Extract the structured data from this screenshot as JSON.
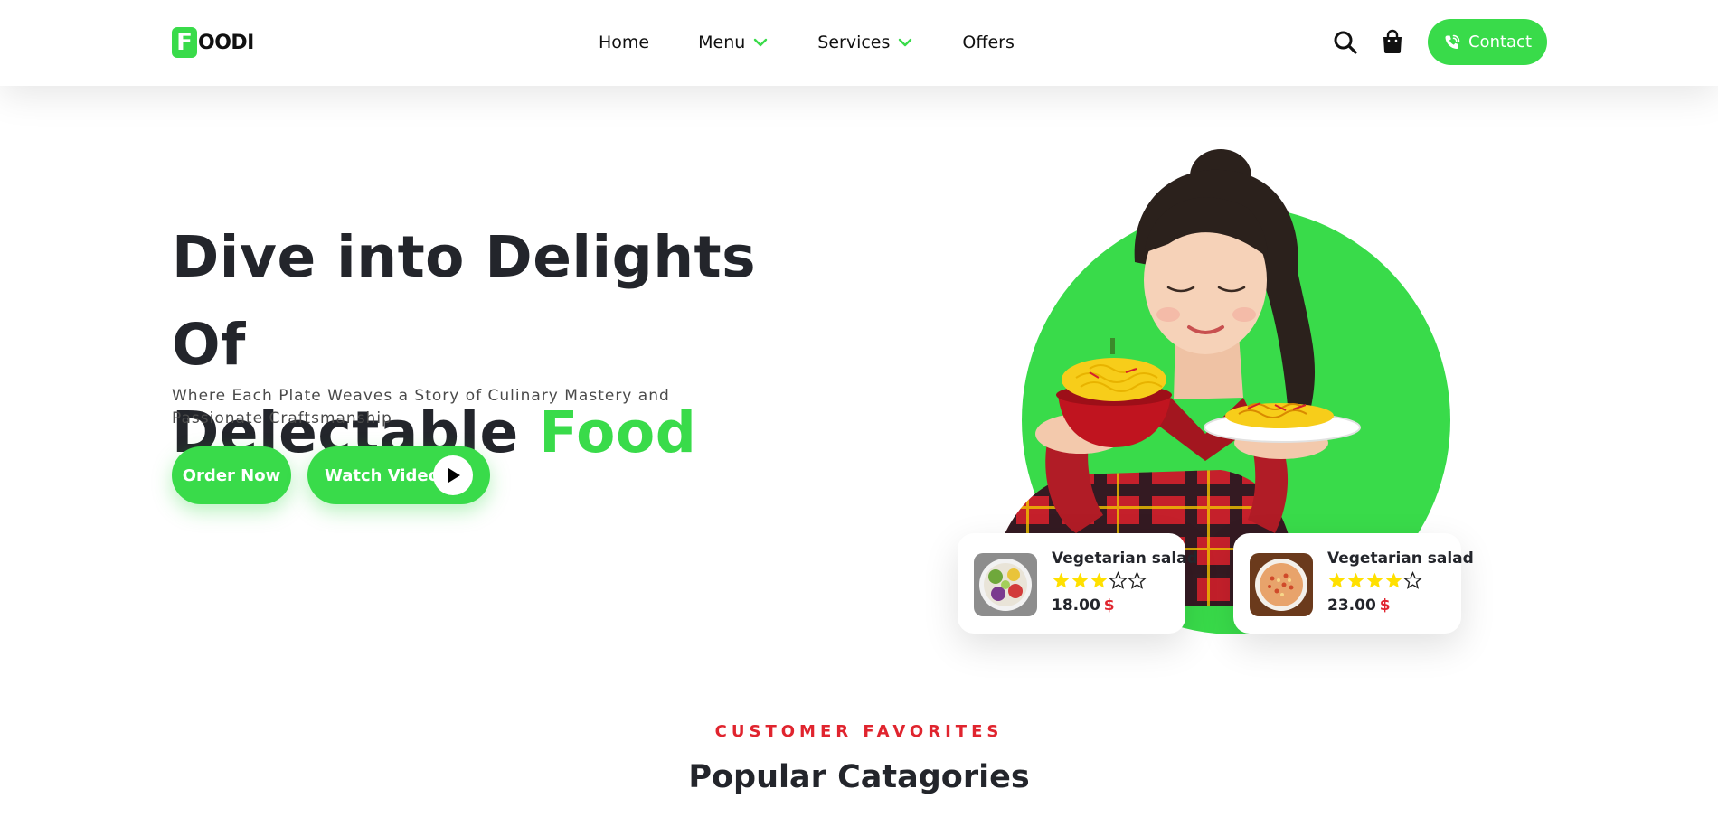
{
  "brand": {
    "logo_letter": "F",
    "logo_text": "OODI",
    "accent_color": "#39db4a",
    "secondary_color": "#e0242e"
  },
  "nav": {
    "items": [
      {
        "label": "Home",
        "has_dropdown": false
      },
      {
        "label": "Menu",
        "has_dropdown": true
      },
      {
        "label": "Services",
        "has_dropdown": true
      },
      {
        "label": "Offers",
        "has_dropdown": false
      }
    ],
    "icons": [
      "search-icon",
      "shopping-bag-icon",
      "phone-icon"
    ],
    "contact_label": "Contact"
  },
  "hero": {
    "title_line1": "Dive into Delights Of",
    "title_line2": "Delectable",
    "title_accent": "Food",
    "subtitle": "Where Each Plate Weaves a Story of Culinary Mastery and Passionate Craftsmanship",
    "order_label": "Order Now",
    "watch_label": "Watch Video"
  },
  "cards": [
    {
      "name": "Vegetarian salad",
      "rating": 3,
      "max_rating": 5,
      "price": "18.00",
      "currency": "$"
    },
    {
      "name": "Vegetarian salad",
      "rating": 4,
      "max_rating": 5,
      "price": "23.00",
      "currency": "$"
    }
  ],
  "section": {
    "kicker": "CUSTOMER FAVORITES",
    "title": "Popular Catagories"
  }
}
